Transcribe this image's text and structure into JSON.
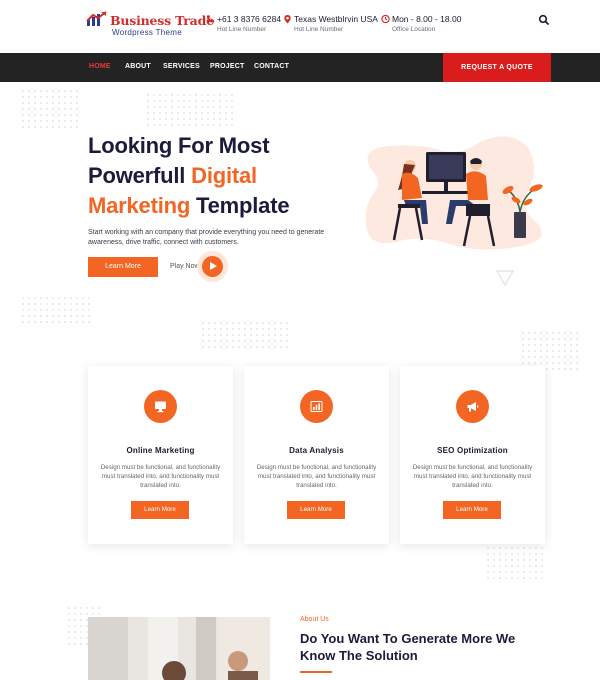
{
  "brand": {
    "title": "Business Trade",
    "subtitle": "Wordpress Theme"
  },
  "contacts": [
    {
      "icon": "phone-icon",
      "main": "+61 3 8376 6284",
      "sub": "Hot Line Number"
    },
    {
      "icon": "location-pin-icon",
      "main": "Texas Westblrvin USA",
      "sub": "Hot Line Number"
    },
    {
      "icon": "clock-icon",
      "main": "Mon - 8.00 - 18.00",
      "sub": "Office Location"
    }
  ],
  "nav": {
    "items": [
      "HOME",
      "ABOUT",
      "SERVICES",
      "PROJECT",
      "CONTACT"
    ],
    "active": "HOME",
    "quote_label": "REQUEST A QUOTE"
  },
  "hero": {
    "title_line1": "Looking For Most",
    "title_line2_a": "Powerfull ",
    "title_line2_b": "Digital",
    "title_line3_a": "Marketing",
    "title_line3_b": " Template",
    "description": "Start working with an company that provide everything you need to generate awareness, drive traffic, connect with customers.",
    "learn_more": "Learn More",
    "play_now": "Play Now"
  },
  "services": [
    {
      "icon": "monitor-icon",
      "title": "Online Marketing",
      "text": "Design must be functional, and functionality must translated into, and functionality must translated into.",
      "button": "Learn More"
    },
    {
      "icon": "bar-chart-icon",
      "title": "Data Analysis",
      "text": "Design must be functional, and functionality must translated into, and functionality must translated into.",
      "button": "Learn More"
    },
    {
      "icon": "megaphone-icon",
      "title": "SEO Optimization",
      "text": "Design must be functional, and functionality must translated into, and functionality must translated into.",
      "button": "Learn More"
    }
  ],
  "about": {
    "tag": "About Us",
    "title_line1": "Do You Want To Generate More We",
    "title_line2": "Know The Solution"
  },
  "colors": {
    "accent": "#f26522",
    "nav_bg": "#232323",
    "quote_bg": "#d91c1c",
    "heading": "#1b1b3b"
  }
}
